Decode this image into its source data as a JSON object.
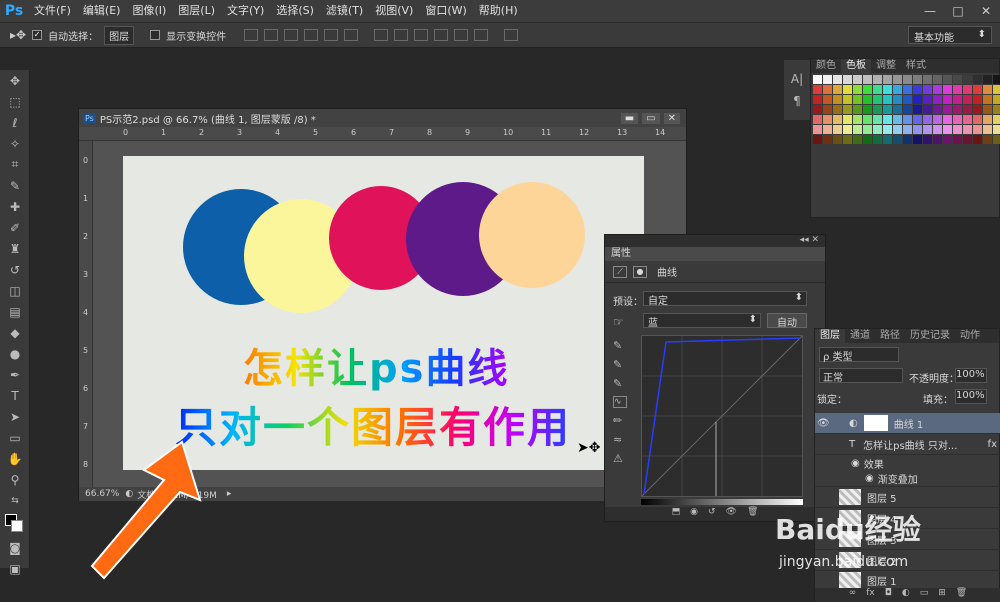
{
  "app": {
    "logo": "Ps"
  },
  "menu": [
    "文件(F)",
    "编辑(E)",
    "图像(I)",
    "图层(L)",
    "文字(Y)",
    "选择(S)",
    "滤镜(T)",
    "视图(V)",
    "窗口(W)",
    "帮助(H)"
  ],
  "window_controls": [
    "—",
    "□",
    "✕"
  ],
  "options": {
    "auto_select_label": "自动选择：",
    "auto_select_value": "图层",
    "show_transform_label": "显示变换控件",
    "workspace": "基本功能"
  },
  "color_panel": {
    "tabs": [
      "颜色",
      "色板",
      "调整",
      "样式"
    ]
  },
  "document": {
    "title": "PS示范2.psd @ 66.7% (曲线 1, 图层蒙版 /8) *",
    "zoom": "66.67%",
    "doc_size": "文档:1.72M/4.19M",
    "ruler_top": [
      "0",
      "1",
      "2",
      "3",
      "4",
      "5",
      "6",
      "7",
      "8",
      "9",
      "10",
      "11",
      "12",
      "13",
      "14"
    ],
    "ruler_left": [
      "0",
      "1",
      "2",
      "3",
      "4",
      "5",
      "6",
      "7",
      "8"
    ],
    "line1": "怎样让ps曲线",
    "line2": "只对一个图层有作用"
  },
  "properties": {
    "title": "属性",
    "type_label": "曲线",
    "preset_label": "预设：",
    "preset_value": "自定",
    "channel_value": "蓝",
    "auto_button": "自动"
  },
  "layers": {
    "tabs": [
      "图层",
      "通道",
      "路径",
      "历史记录",
      "动作"
    ],
    "filter_label": "类型",
    "blend_mode": "正常",
    "opacity_label": "不透明度：",
    "opacity_value": "100%",
    "lock_label": "锁定：",
    "fill_label": "填充：",
    "fill_value": "100%",
    "rows": [
      "曲线 1",
      "怎样让ps曲线 只对...",
      "效果",
      "渐变叠加",
      "图层 5",
      "图层 4",
      "图层 3",
      "图层 2",
      "图层 1"
    ]
  },
  "watermark": {
    "brand": "Baidu经验",
    "url": "jingyan.baidu.com"
  },
  "colors": {
    "accent": "#ff6a13",
    "blue": "#0c5fa8",
    "yellow": "#fbf69b",
    "crimson": "#e0125a",
    "purple": "#5d1a88",
    "peach": "#fdd598"
  }
}
